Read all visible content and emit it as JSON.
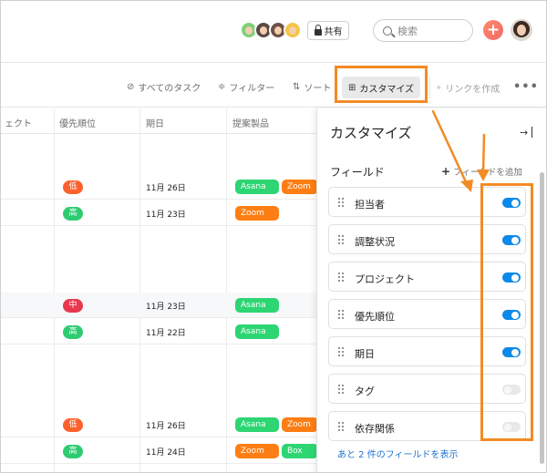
{
  "topbar": {
    "share_label": "共有",
    "search_placeholder": "検索",
    "add_label": "+"
  },
  "toolbar": {
    "all_tasks": "すべてのタスク",
    "filter": "フィルター",
    "sort": "ソート",
    "customize": "カスタマイズ",
    "create_link": "リンクを作成",
    "more": "•••"
  },
  "table": {
    "columns": [
      "ェクト",
      "優先順位",
      "期日",
      "提案製品"
    ],
    "rows": [
      {
        "priority": "低",
        "priority_color": "#fd612c",
        "date": "11月 26日",
        "tags": [
          {
            "label": "Asana",
            "color": "#2ed573"
          },
          {
            "label": "Zoom",
            "color": "#fd7e14"
          }
        ]
      },
      {
        "priority": "高",
        "priority_color": "#2ecc71",
        "date": "11月 23日",
        "tags": [
          {
            "label": "Zoom",
            "color": "#fd7e14"
          }
        ]
      },
      {
        "priority": "中",
        "priority_color": "#e8384f",
        "date": "11月 23日",
        "tags": [
          {
            "label": "Asana",
            "color": "#2ed573"
          }
        ]
      },
      {
        "priority": "高",
        "priority_color": "#2ecc71",
        "date": "11月 22日",
        "tags": [
          {
            "label": "Asana",
            "color": "#2ed573"
          }
        ]
      },
      {
        "priority": "低",
        "priority_color": "#fd612c",
        "date": "11月 26日",
        "tags": [
          {
            "label": "Asana",
            "color": "#2ed573"
          },
          {
            "label": "Zoom",
            "color": "#fd7e14"
          }
        ]
      },
      {
        "priority": "高",
        "priority_color": "#2ecc71",
        "date": "11月 24日",
        "tags": [
          {
            "label": "Zoom",
            "color": "#fd7e14"
          },
          {
            "label": "Box",
            "color": "#2ed573"
          }
        ]
      }
    ]
  },
  "panel": {
    "title": "カスタマイズ",
    "fields_label": "フィールド",
    "add_field": "フィールドを追加",
    "fields": [
      {
        "label": "担当者",
        "enabled": true
      },
      {
        "label": "調整状況",
        "enabled": true
      },
      {
        "label": "プロジェクト",
        "enabled": true
      },
      {
        "label": "優先順位",
        "enabled": true
      },
      {
        "label": "期日",
        "enabled": true
      },
      {
        "label": "タグ",
        "enabled": false
      },
      {
        "label": "依存関係",
        "enabled": false
      }
    ],
    "show_more": "あと 2 件のフィールドを表示"
  },
  "colors": {
    "accent_orange": "#f28b24",
    "toggle_on": "#0d8ae8",
    "link_blue": "#1f73d1"
  }
}
